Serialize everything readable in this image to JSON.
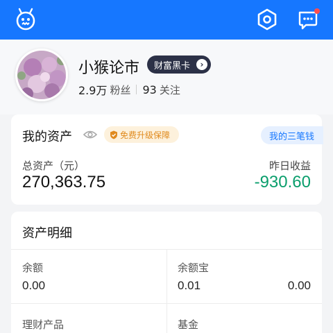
{
  "colors": {
    "primary": "#1677ff",
    "vip_badge_bg": "#2c3147",
    "guard_text": "#e08a1e",
    "negative_change": "#0a9e6c"
  },
  "header": {
    "logo_icon": "monkey-logo-icon",
    "settings_icon": "settings-hexagon-icon",
    "message_icon": "message-chat-icon"
  },
  "profile": {
    "username": "小猴论市",
    "badge_label": "财富黑卡",
    "followers_count": "2.9万",
    "followers_label": "粉丝",
    "following_count": "93",
    "following_label": "关注"
  },
  "assets": {
    "title": "我的资产",
    "guard_label": "免费升级保障",
    "three_money_label": "我的三笔钱",
    "total_label": "总资产（元）",
    "total_value": "270,363.75",
    "yesterday_label": "昨日收益",
    "yesterday_value": "-930.60"
  },
  "detail": {
    "title": "资产明细",
    "items": [
      {
        "label": "余额",
        "value": "0.00"
      },
      {
        "label": "余额宝",
        "value": "0.01",
        "value2": "0.00"
      },
      {
        "label": "理财产品"
      },
      {
        "label": "基金"
      }
    ]
  }
}
